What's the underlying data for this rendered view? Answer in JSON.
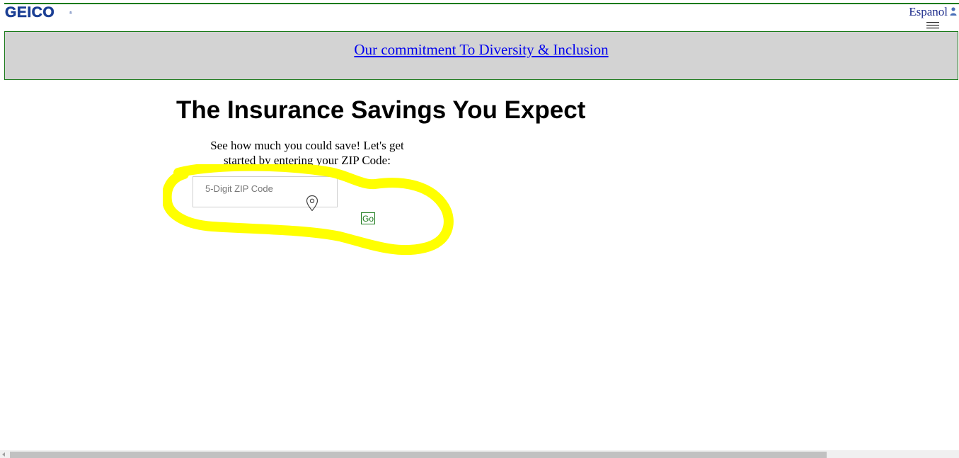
{
  "header": {
    "logo_text": "GEICO",
    "logo_reg": "®",
    "espanol_label": "Espanol",
    "icons": [
      "person-icon",
      "menu-icon"
    ]
  },
  "banner": {
    "link_text": "Our commitment To Diversity & Inclusion"
  },
  "main": {
    "headline": "The Insurance Savings You Expect",
    "subtext": "See how much you could save! Let's get started by entering your ZIP Code:",
    "zip_placeholder": "5-Digit ZIP Code",
    "zip_value": "",
    "go_label": "Go",
    "icons": [
      "location-pin-icon"
    ]
  },
  "colors": {
    "brand_blue": "#1b3f94",
    "border_green": "#1a7a1a",
    "banner_gray": "#d3d3d3",
    "link_blue": "#0000ee",
    "highlight_yellow": "#ffff00"
  }
}
